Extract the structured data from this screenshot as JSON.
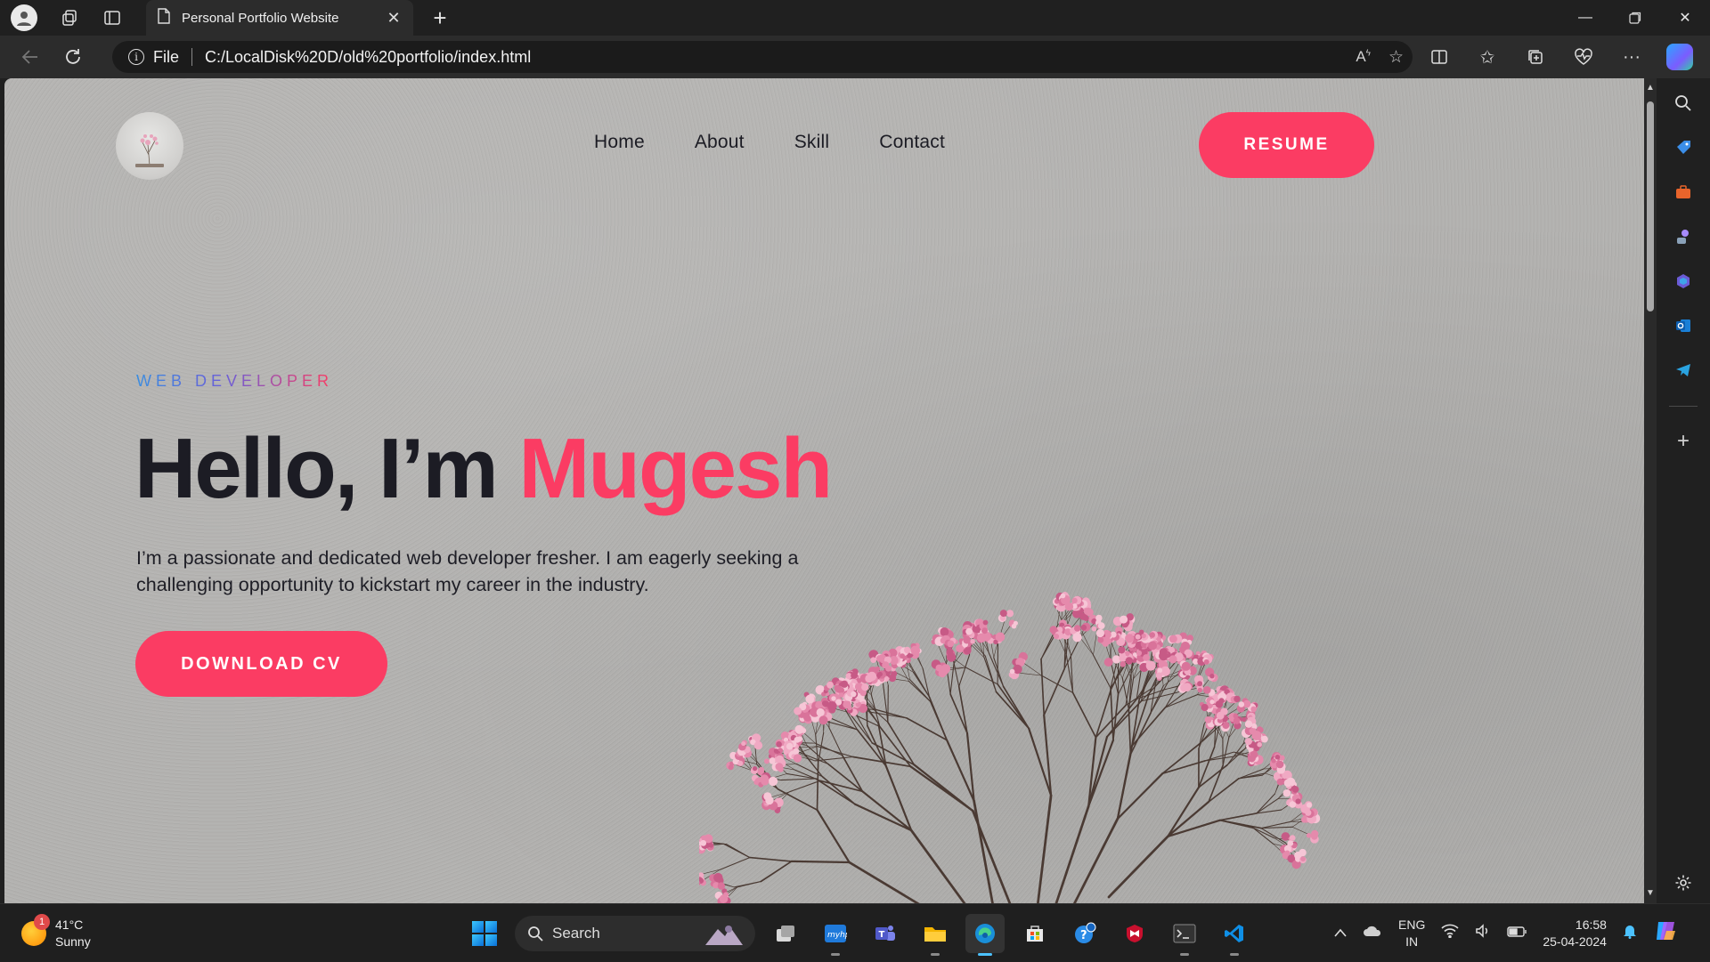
{
  "browser": {
    "tab_title": "Personal Portfolio Website",
    "address_prefix": "File",
    "url": "C:/LocalDisk%20D/old%20portfolio/index.html"
  },
  "page": {
    "nav": [
      "Home",
      "About",
      "Skill",
      "Contact"
    ],
    "resume_label": "RESUME",
    "subtitle": "WEB DEVELOPER",
    "headline_prefix": "Hello, I’m ",
    "headline_name": "Mugesh",
    "description": "I’m a passionate and dedicated web developer fresher. I am eagerly seeking a challenging opportunity to kickstart my career in the industry.",
    "cta_label": "DOWNLOAD CV",
    "accent_color": "#fb3c63",
    "text_color": "#1c1c24"
  },
  "taskbar": {
    "weather_temp": "41°C",
    "weather_desc": "Sunny",
    "weather_badge": "1",
    "search_label": "Search",
    "lang_top": "ENG",
    "lang_bottom": "IN",
    "time": "16:58",
    "date": "25-04-2024"
  },
  "icons": [
    "profile-icon",
    "workspaces-icon",
    "tab-actions-icon",
    "page-icon",
    "close-icon",
    "plus-icon",
    "minimize-icon",
    "restore-icon",
    "back-icon",
    "refresh-icon",
    "info-icon",
    "read-aloud-icon",
    "favorite-star-icon",
    "split-screen-icon",
    "favorites-icon",
    "collections-icon",
    "browser-essentials-icon",
    "more-icon",
    "copilot-icon",
    "search-icon",
    "shopping-icon",
    "tools-icon",
    "games-icon",
    "m365-icon",
    "outlook-icon",
    "telegram-icon",
    "add-icon",
    "settings-icon",
    "windows-icon"
  ]
}
